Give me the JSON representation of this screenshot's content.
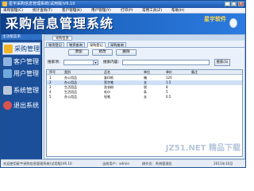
{
  "window": {
    "title": "星宇采购信息管理系统(试用版)V6.10"
  },
  "menubar": {
    "items": [
      "采购管理(C)",
      "统计查询(T)",
      "客户管理(K)",
      "用户管理(Y)",
      "打印(P)",
      "常用工具(Z)",
      "帮助(H)"
    ]
  },
  "banner": {
    "title": "采购信息管理系统",
    "brand": "星宇软件"
  },
  "sidebar": {
    "header": "主功能菜单",
    "items": [
      {
        "label": "采购管理",
        "icon": "cart-icon",
        "color": "#f0b429"
      },
      {
        "label": "客户管理",
        "icon": "users-icon",
        "color": "#8fb3e0"
      },
      {
        "label": "用户管理",
        "icon": "user-icon",
        "color": "#6fa8dc"
      },
      {
        "label": "系统管理",
        "icon": "computer-icon",
        "color": "#b9c7d8"
      },
      {
        "label": "退出系统",
        "icon": "exit-icon",
        "color": "#d9534f"
      }
    ]
  },
  "main": {
    "panel_tab": "采购信息",
    "tabs": [
      "物资登记",
      "物资查询",
      "采购登记",
      "采购查询"
    ],
    "toolbar": {
      "add_label": "添加",
      "modify_label": "修改",
      "delete_label": "删除"
    },
    "search": {
      "type_label": "搜索项：",
      "type_value": "",
      "content_label": "搜索内容：",
      "content_value": "",
      "button_label": "搜索(S)"
    },
    "grid": {
      "columns": [
        "序号",
        "类别",
        "品名",
        "单位",
        "单价",
        "备注"
      ],
      "rows": [
        [
          "1",
          "办公用品",
          "复印纸",
          "箱",
          "120",
          ""
        ],
        [
          "2",
          "办公用品",
          "签字笔",
          "支",
          "1.5",
          ""
        ],
        [
          "3",
          "生活用品",
          "洗衣粉",
          "袋",
          "8",
          ""
        ],
        [
          "4",
          "生活用品",
          "毛巾",
          "条",
          "5",
          ""
        ],
        [
          "5",
          "办公用品",
          "铅笔",
          "支",
          "0.5",
          ""
        ]
      ],
      "selected_row": 1
    }
  },
  "statusbar": {
    "items": [
      "欢迎使用星宇采购信息管理系统(试用版)V6.10",
      "当前用户：admin",
      "操作员：系统管理员",
      "2011年10月"
    ]
  },
  "watermark": "JZ51.NET 精品下载"
}
